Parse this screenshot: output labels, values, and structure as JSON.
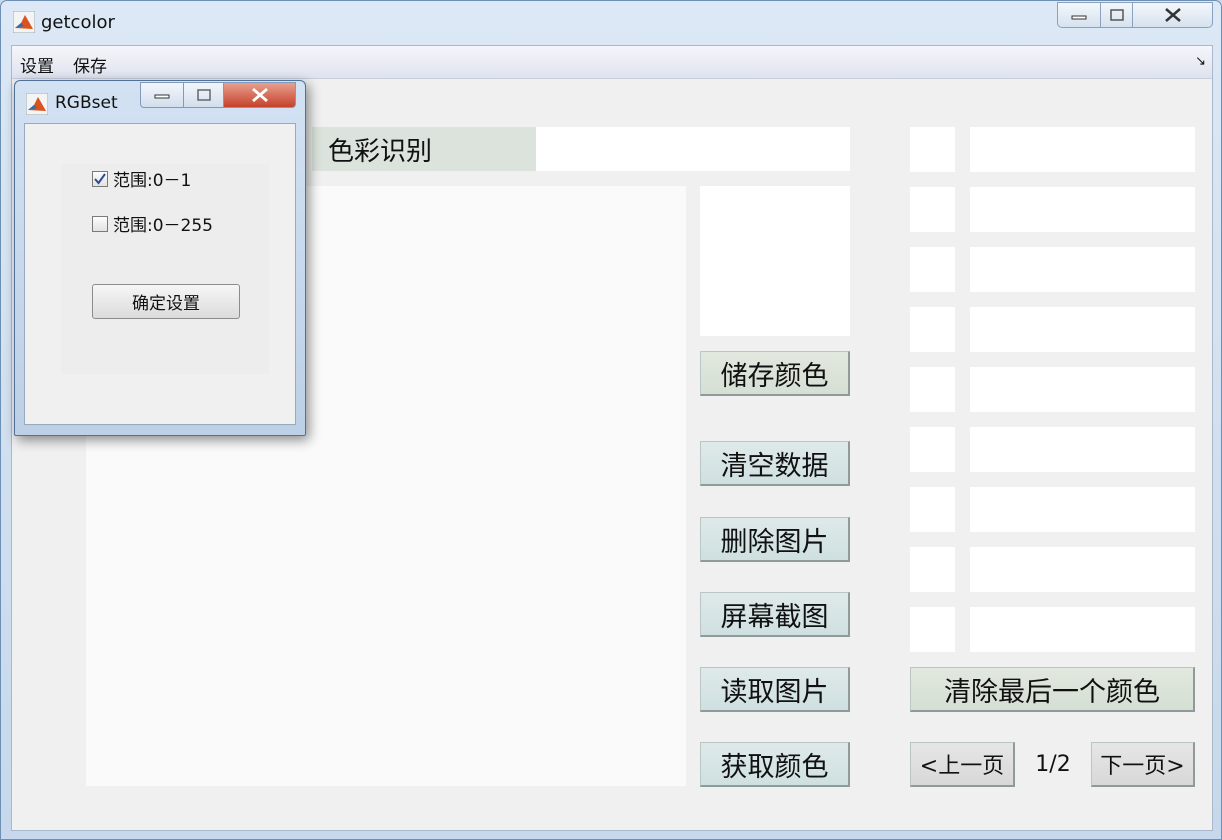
{
  "window": {
    "title": "getcolor"
  },
  "menu": {
    "items": [
      "设置",
      "保存"
    ],
    "dock_arrow": "↘"
  },
  "main": {
    "header_label": "色彩识别",
    "buttons": {
      "save_color": "储存颜色",
      "clear_data": "清空数据",
      "delete_image": "删除图片",
      "screenshot": "屏幕截图",
      "read_image": "读取图片",
      "get_color": "获取颜色",
      "clear_last_color": "清除最后一个颜色",
      "prev_page": "<上一页",
      "next_page": "下一页>"
    },
    "page_indicator": "1/2",
    "color_slot_count": 9
  },
  "dialog": {
    "title": "RGBset",
    "options": [
      {
        "label": "范围:0－1",
        "checked": true
      },
      {
        "label": "范围:0－255",
        "checked": false
      }
    ],
    "confirm_label": "确定设置"
  },
  "colors": {
    "header_label_bg": "#dbe3dc",
    "button_face": "#cfe0e0",
    "close_button_red": "#c6412a",
    "client_bg": "#f0f0f0"
  }
}
